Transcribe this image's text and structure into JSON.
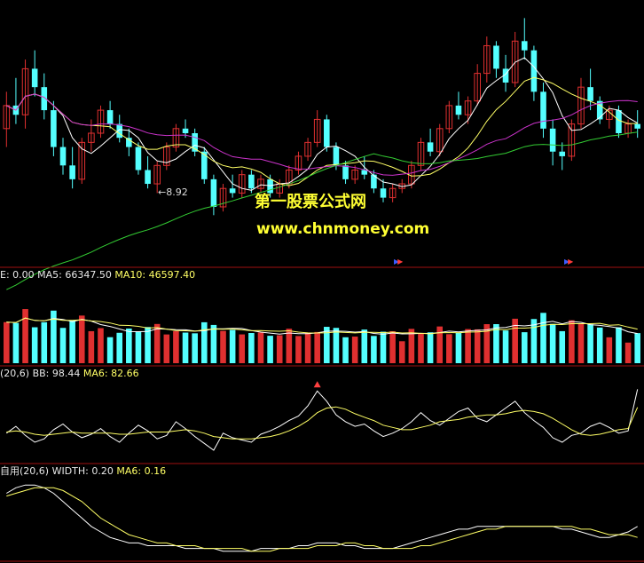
{
  "watermark": {
    "title": "第一股票公式网",
    "url": "www.chnmoney.com"
  },
  "colors": {
    "background": "#000000",
    "panel_border": "#a01010",
    "up": "#e03030",
    "down": "#54ffff",
    "ma_white": "#ffffff",
    "ma_yellow": "#ffff66",
    "ma_purple": "#cc33cc",
    "ma_green": "#33cc33",
    "label_yellow": "#ffff33"
  },
  "price_panel": {
    "low_label": "8.92"
  },
  "volume_panel": {
    "legend": [
      {
        "text": "E: 0.00",
        "color": "white"
      },
      {
        "text": "MA5: 66347.50",
        "color": "white"
      },
      {
        "text": "MA10: 46597.40",
        "color": "yellow"
      }
    ]
  },
  "bb_panel": {
    "legend": [
      {
        "text": "(20,6)",
        "color": "white"
      },
      {
        "text": "BB: 98.44",
        "color": "white"
      },
      {
        "text": "MA6: 82.66",
        "color": "yellow"
      }
    ]
  },
  "width_panel": {
    "legend": [
      {
        "text": "自用(20,6)",
        "color": "white"
      },
      {
        "text": "WIDTH: 0.20",
        "color": "white"
      },
      {
        "text": "MA6: 0.16",
        "color": "yellow"
      }
    ]
  },
  "chart_data": [
    {
      "type": "candlestick",
      "title": "",
      "annotations": [
        "8.92"
      ],
      "ohlc": [
        [
          10.8,
          11.6,
          10.4,
          11.3
        ],
        [
          11.3,
          11.9,
          10.9,
          11.1
        ],
        [
          11.1,
          12.3,
          10.8,
          12.1
        ],
        [
          12.1,
          12.5,
          11.5,
          11.7
        ],
        [
          11.7,
          12.0,
          11.0,
          11.2
        ],
        [
          11.2,
          11.4,
          10.2,
          10.4
        ],
        [
          10.4,
          10.6,
          9.8,
          10.0
        ],
        [
          10.0,
          10.4,
          9.5,
          9.7
        ],
        [
          9.7,
          10.6,
          9.6,
          10.5
        ],
        [
          10.5,
          11.0,
          10.3,
          10.7
        ],
        [
          10.7,
          11.3,
          10.6,
          11.2
        ],
        [
          11.2,
          11.4,
          10.8,
          10.9
        ],
        [
          10.9,
          11.1,
          10.5,
          10.6
        ],
        [
          10.6,
          10.8,
          10.2,
          10.4
        ],
        [
          10.4,
          10.5,
          9.8,
          9.9
        ],
        [
          9.9,
          10.2,
          9.5,
          9.6
        ],
        [
          9.6,
          10.1,
          9.4,
          10.0
        ],
        [
          10.0,
          10.5,
          9.9,
          10.4
        ],
        [
          10.4,
          10.9,
          10.3,
          10.8
        ],
        [
          10.8,
          11.0,
          10.6,
          10.7
        ],
        [
          10.7,
          10.8,
          10.2,
          10.3
        ],
        [
          10.3,
          10.4,
          9.6,
          9.7
        ],
        [
          9.7,
          9.8,
          8.92,
          9.1
        ],
        [
          9.1,
          9.6,
          9.0,
          9.5
        ],
        [
          9.5,
          9.8,
          9.3,
          9.4
        ],
        [
          9.4,
          9.9,
          9.3,
          9.8
        ],
        [
          9.8,
          9.9,
          9.4,
          9.5
        ],
        [
          9.5,
          9.8,
          9.4,
          9.7
        ],
        [
          9.7,
          9.8,
          9.3,
          9.4
        ],
        [
          9.4,
          9.7,
          9.3,
          9.6
        ],
        [
          9.6,
          10.0,
          9.5,
          9.9
        ],
        [
          9.9,
          10.3,
          9.8,
          10.2
        ],
        [
          10.2,
          10.6,
          10.1,
          10.5
        ],
        [
          10.5,
          11.2,
          10.4,
          11.0
        ],
        [
          11.0,
          11.1,
          10.3,
          10.4
        ],
        [
          10.4,
          10.5,
          9.9,
          10.0
        ],
        [
          10.0,
          10.1,
          9.6,
          9.7
        ],
        [
          9.7,
          10.0,
          9.6,
          9.9
        ],
        [
          9.9,
          10.2,
          9.7,
          9.8
        ],
        [
          9.8,
          9.9,
          9.4,
          9.5
        ],
        [
          9.5,
          9.7,
          9.2,
          9.3
        ],
        [
          9.3,
          9.6,
          9.2,
          9.5
        ],
        [
          9.5,
          9.7,
          9.4,
          9.6
        ],
        [
          9.6,
          10.1,
          9.5,
          10.0
        ],
        [
          10.0,
          10.6,
          9.9,
          10.5
        ],
        [
          10.5,
          10.8,
          10.2,
          10.3
        ],
        [
          10.3,
          10.9,
          10.2,
          10.8
        ],
        [
          10.8,
          11.4,
          10.7,
          11.3
        ],
        [
          11.3,
          11.6,
          11.0,
          11.1
        ],
        [
          11.1,
          11.5,
          10.9,
          11.4
        ],
        [
          11.4,
          12.2,
          11.3,
          12.0
        ],
        [
          12.0,
          12.8,
          11.8,
          12.6
        ],
        [
          12.6,
          12.7,
          11.9,
          12.1
        ],
        [
          12.1,
          12.4,
          11.6,
          11.8
        ],
        [
          11.8,
          12.9,
          11.7,
          12.7
        ],
        [
          12.7,
          13.2,
          12.3,
          12.5
        ],
        [
          12.5,
          12.6,
          11.4,
          11.6
        ],
        [
          11.6,
          11.8,
          10.6,
          10.8
        ],
        [
          10.8,
          11.0,
          10.0,
          10.3
        ],
        [
          10.3,
          10.5,
          9.9,
          10.2
        ],
        [
          10.2,
          11.0,
          10.1,
          10.9
        ],
        [
          10.9,
          11.9,
          10.8,
          11.7
        ],
        [
          11.7,
          12.1,
          11.2,
          11.4
        ],
        [
          11.4,
          11.5,
          10.9,
          11.0
        ],
        [
          11.0,
          11.3,
          10.8,
          11.2
        ],
        [
          11.2,
          11.3,
          10.6,
          10.7
        ],
        [
          10.7,
          11.0,
          10.6,
          10.9
        ],
        [
          10.9,
          11.2,
          10.6,
          10.8
        ]
      ]
    },
    {
      "type": "bar",
      "title": "",
      "series": [
        {
          "name": "MA5",
          "values": [
            66347.5
          ]
        },
        {
          "name": "MA10",
          "values": [
            46597.4
          ]
        }
      ]
    },
    {
      "type": "line",
      "title": "",
      "series": [
        {
          "name": "BB",
          "values": [
            60,
            66,
            58,
            52,
            55,
            63,
            68,
            61,
            56,
            59,
            64,
            57,
            52,
            60,
            67,
            62,
            55,
            58,
            70,
            64,
            57,
            51,
            45,
            60,
            56,
            54,
            52,
            59,
            62,
            66,
            71,
            75,
            84,
            97,
            88,
            76,
            70,
            66,
            68,
            62,
            57,
            60,
            64,
            70,
            78,
            71,
            67,
            73,
            79,
            82,
            73,
            70,
            76,
            82,
            88,
            78,
            71,
            65,
            56,
            52,
            58,
            60,
            66,
            69,
            65,
            60,
            62,
            98.44
          ]
        },
        {
          "name": "MA6",
          "values": [
            61,
            62,
            61,
            59,
            58,
            59,
            60,
            61,
            60,
            60,
            60,
            60,
            59,
            59,
            60,
            61,
            61,
            61,
            62,
            63,
            62,
            60,
            57,
            56,
            55,
            55,
            55,
            56,
            57,
            59,
            62,
            66,
            71,
            78,
            82,
            83,
            81,
            77,
            74,
            71,
            67,
            65,
            63,
            63,
            65,
            67,
            70,
            71,
            72,
            74,
            75,
            76,
            76,
            77,
            79,
            80,
            79,
            77,
            73,
            68,
            63,
            59,
            58,
            59,
            61,
            63,
            64,
            82.66
          ]
        }
      ]
    },
    {
      "type": "line",
      "title": "",
      "series": [
        {
          "name": "WIDTH",
          "values": [
            0.32,
            0.34,
            0.35,
            0.35,
            0.34,
            0.32,
            0.29,
            0.26,
            0.23,
            0.2,
            0.18,
            0.16,
            0.15,
            0.14,
            0.14,
            0.13,
            0.13,
            0.13,
            0.13,
            0.12,
            0.12,
            0.12,
            0.12,
            0.11,
            0.11,
            0.11,
            0.11,
            0.12,
            0.12,
            0.12,
            0.12,
            0.13,
            0.13,
            0.14,
            0.14,
            0.14,
            0.13,
            0.13,
            0.12,
            0.12,
            0.12,
            0.12,
            0.13,
            0.14,
            0.15,
            0.16,
            0.17,
            0.18,
            0.19,
            0.19,
            0.2,
            0.2,
            0.2,
            0.2,
            0.2,
            0.2,
            0.2,
            0.2,
            0.2,
            0.19,
            0.19,
            0.18,
            0.17,
            0.16,
            0.16,
            0.17,
            0.18,
            0.2
          ]
        },
        {
          "name": "MA6",
          "values": [
            0.31,
            0.32,
            0.33,
            0.34,
            0.34,
            0.34,
            0.33,
            0.31,
            0.29,
            0.26,
            0.23,
            0.21,
            0.19,
            0.17,
            0.16,
            0.15,
            0.14,
            0.14,
            0.13,
            0.13,
            0.13,
            0.12,
            0.12,
            0.12,
            0.12,
            0.12,
            0.11,
            0.11,
            0.11,
            0.12,
            0.12,
            0.12,
            0.12,
            0.13,
            0.13,
            0.13,
            0.14,
            0.14,
            0.13,
            0.13,
            0.12,
            0.12,
            0.12,
            0.12,
            0.13,
            0.13,
            0.14,
            0.15,
            0.16,
            0.17,
            0.18,
            0.19,
            0.19,
            0.2,
            0.2,
            0.2,
            0.2,
            0.2,
            0.2,
            0.2,
            0.2,
            0.19,
            0.19,
            0.18,
            0.17,
            0.17,
            0.17,
            0.16
          ]
        }
      ]
    }
  ]
}
